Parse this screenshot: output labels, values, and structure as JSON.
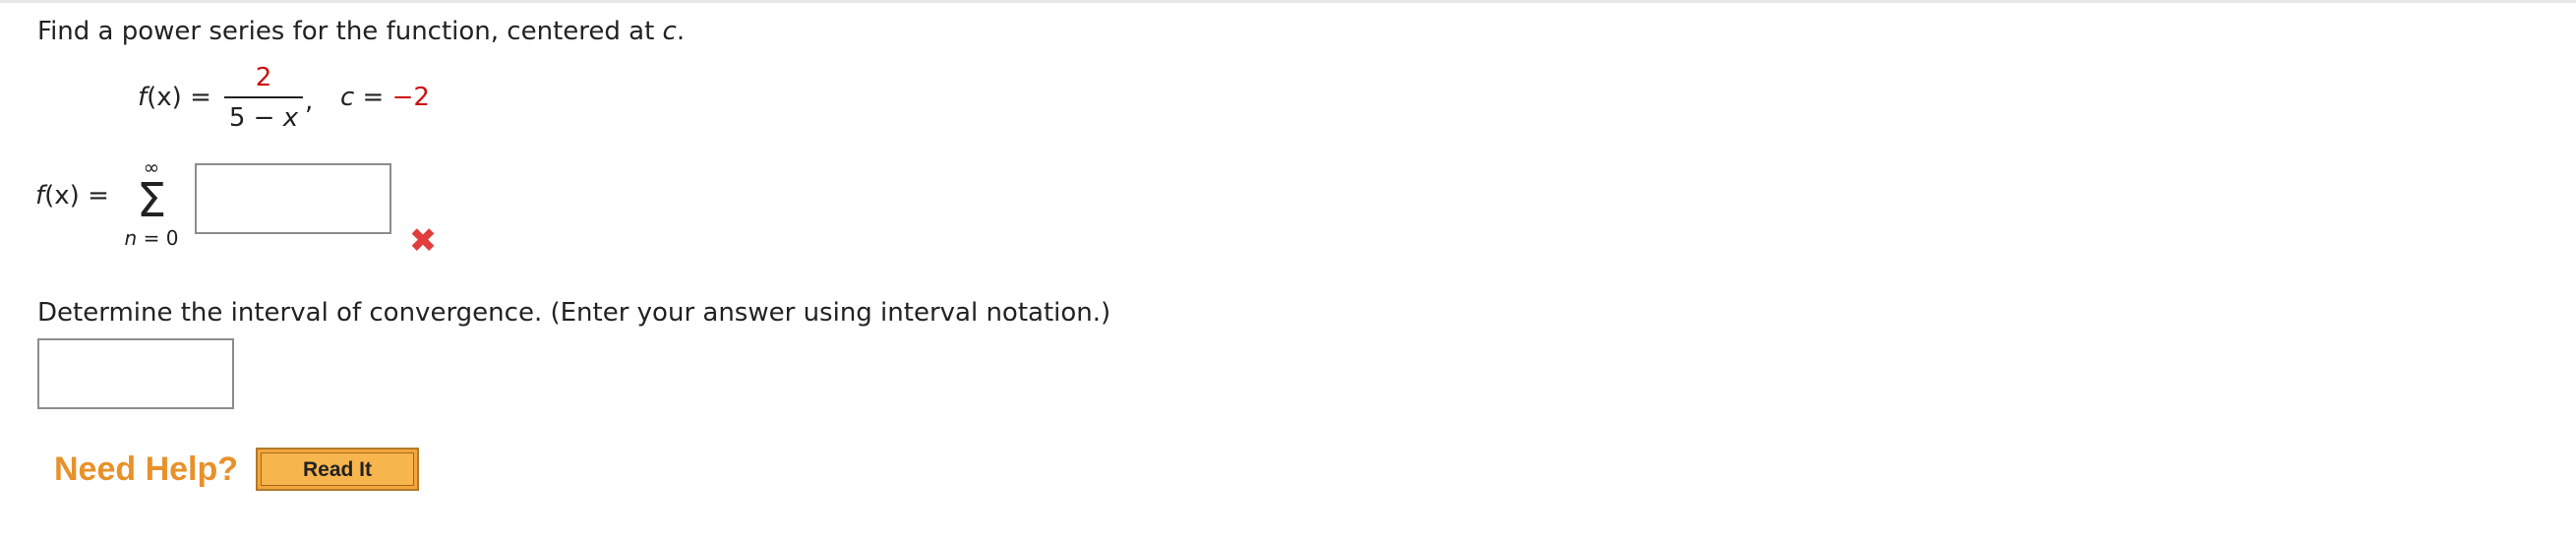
{
  "question": {
    "prefix": "Find a power series for the function, centered at ",
    "var": "c",
    "suffix": "."
  },
  "given": {
    "f": "f",
    "lhs_rest": "(x) =",
    "numerator": "2",
    "denominator_pre": "5 − ",
    "denominator_var": "x",
    "comma": ",",
    "c_var": "c",
    "c_eq": " = ",
    "c_value": "−2"
  },
  "series": {
    "f": "f",
    "lhs_rest": "(x) =",
    "sum_upper": "∞",
    "sum_symbol": "Σ",
    "sum_lower_var": "n",
    "sum_lower_rest": " = 0",
    "answer_value": "",
    "status": "incorrect",
    "status_glyph": "✖"
  },
  "interval": {
    "prompt": "Determine the interval of convergence. (Enter your answer using interval notation.)",
    "answer_value": ""
  },
  "help": {
    "label": "Need Help?",
    "read_it_button": "Read It"
  },
  "colors": {
    "highlight_red": "#cc1111",
    "wrong_icon": "#e23c3c",
    "need_help": "#e8912a",
    "read_it_bg": "#f5a53c"
  }
}
